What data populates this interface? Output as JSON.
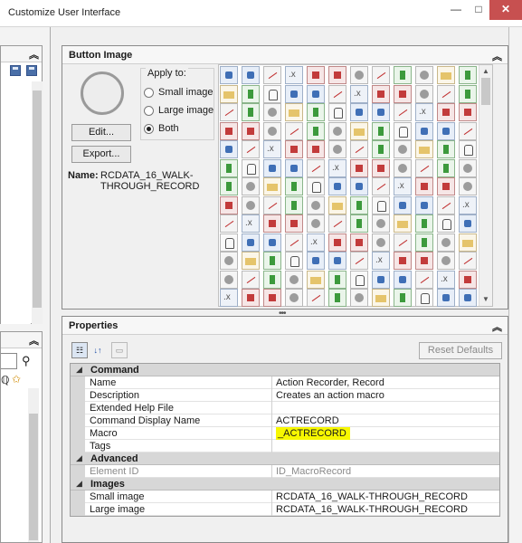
{
  "window": {
    "title": "Customize User Interface",
    "minimize": "—",
    "maximize": "□",
    "close": "✕"
  },
  "button_image": {
    "panel_title": "Button Image",
    "apply_to": {
      "legend": "Apply to:",
      "small": "Small image",
      "large": "Large image",
      "both": "Both",
      "selected": "Both"
    },
    "edit_label": "Edit...",
    "export_label": "Export...",
    "name_label": "Name:",
    "name_value": "RCDATA_16_WALK-THROUGH_RECORD"
  },
  "properties": {
    "panel_title": "Properties",
    "reset_label": "Reset Defaults",
    "categories": [
      {
        "label": "Command",
        "rows": [
          {
            "name": "Name",
            "value": "Action Recorder, Record"
          },
          {
            "name": "Description",
            "value": "Creates an action macro"
          },
          {
            "name": "Extended Help File",
            "value": ""
          },
          {
            "name": "Command Display Name",
            "value": "ACTRECORD"
          },
          {
            "name": "Macro",
            "value": "_ACTRECORD"
          },
          {
            "name": "Tags",
            "value": ""
          }
        ]
      },
      {
        "label": "Advanced",
        "rows": [
          {
            "name": "Element ID",
            "value": "ID_MacroRecord"
          }
        ]
      },
      {
        "label": "Images",
        "rows": [
          {
            "name": "Small image",
            "value": "RCDATA_16_WALK-THROUGH_RECORD"
          },
          {
            "name": "Large image",
            "value": "RCDATA_16_WALK-THROUGH_RECORD"
          }
        ]
      }
    ]
  },
  "colors": {
    "close_button": "#c75050",
    "macro_highlight": "#f7f700"
  }
}
